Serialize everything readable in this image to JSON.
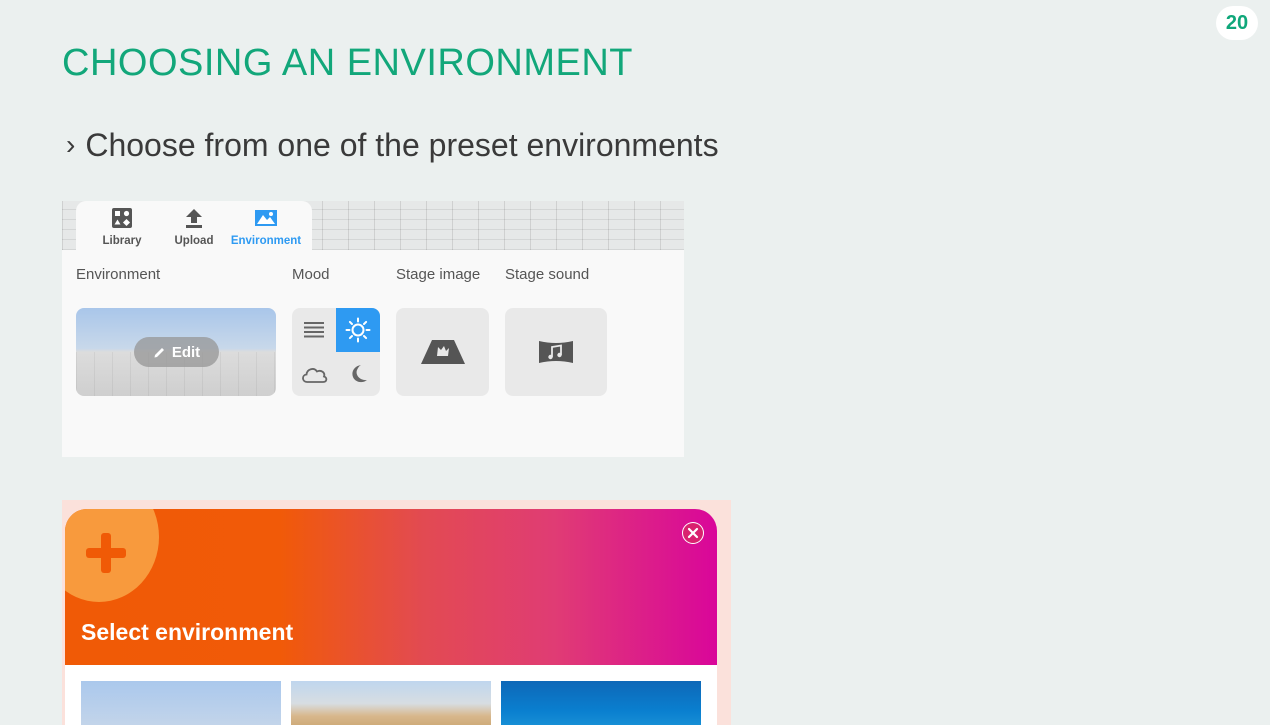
{
  "page_number": "20",
  "title": "CHOOSING AN ENVIRONMENT",
  "bullet": {
    "chevron": "›",
    "text": "Choose from one of the preset environments"
  },
  "editor": {
    "tabs": [
      {
        "label": "Library",
        "icon": "library-icon",
        "active": false
      },
      {
        "label": "Upload",
        "icon": "upload-icon",
        "active": false
      },
      {
        "label": "Environment",
        "icon": "environment-icon",
        "active": true
      }
    ],
    "sections": {
      "environment": "Environment",
      "mood": "Mood",
      "stage_image": "Stage image",
      "stage_sound": "Stage sound"
    },
    "edit_label": "Edit",
    "mood_options": [
      {
        "icon": "list-lines-icon",
        "active": false
      },
      {
        "icon": "sun-icon",
        "active": true
      },
      {
        "icon": "cloud-icon",
        "active": false
      },
      {
        "icon": "moon-icon",
        "active": false
      }
    ],
    "accent_color": "#2e9af2"
  },
  "modal": {
    "title": "Select environment",
    "icon": "plus-icon",
    "close_icon": "close-icon",
    "gradient": [
      "#f15a08",
      "#d9069a"
    ],
    "thumbnails": [
      "sky-environment",
      "desert-environment",
      "ocean-environment"
    ]
  }
}
